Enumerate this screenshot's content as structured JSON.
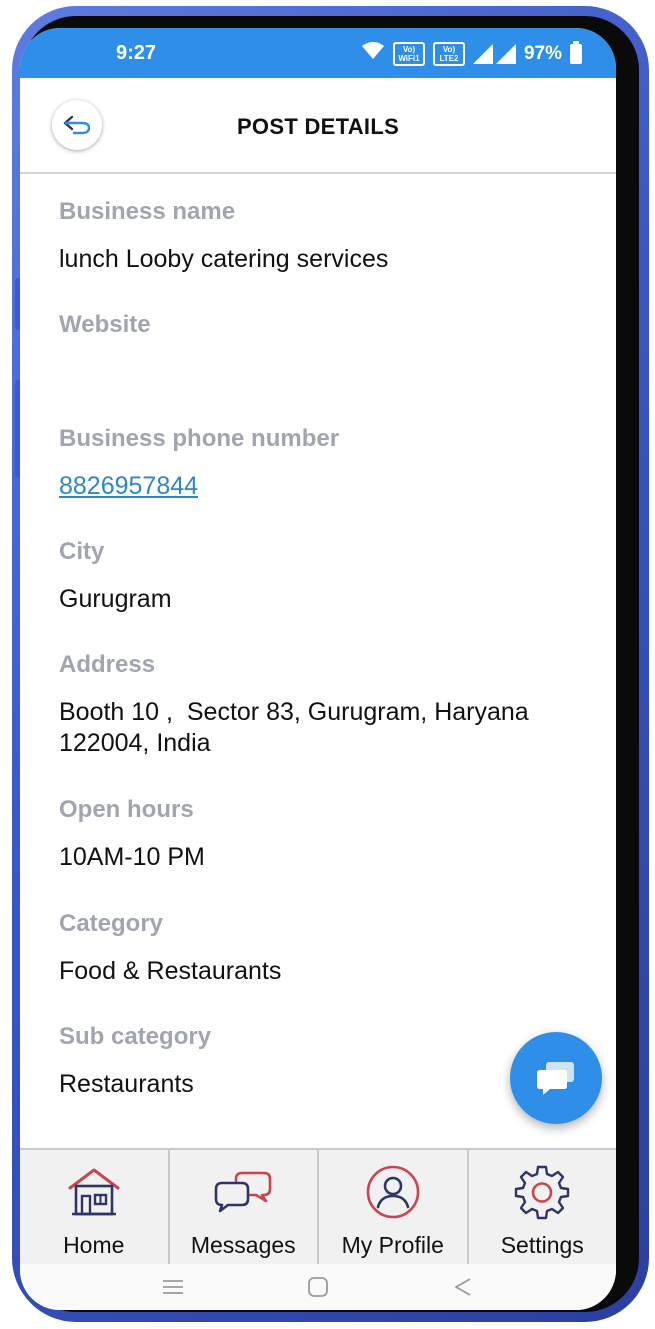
{
  "status_bar": {
    "time": "9:27",
    "sim1": "Vo) WiFi1",
    "sim2": "Vo) LTE2",
    "battery": "97%",
    "icons": [
      "wifi-icon",
      "sim1-badge-icon",
      "sim2-badge-icon",
      "signal-icon",
      "battery-icon"
    ]
  },
  "header": {
    "title": "POST DETAILS",
    "back_icon": "back-arrow-icon"
  },
  "fields": [
    {
      "label": "Business name",
      "value": "lunch Looby catering services"
    },
    {
      "label": "Website",
      "value": ""
    },
    {
      "label": "Business phone number",
      "value": "8826957844"
    },
    {
      "label": "City",
      "value": "Gurugram"
    },
    {
      "label": "Address",
      "value": "Booth 10 ,  Sector 83, Gurugram, Haryana 122004, India"
    },
    {
      "label": "Open hours",
      "value": "10AM-10 PM"
    },
    {
      "label": "Category",
      "value": "Food & Restaurants"
    },
    {
      "label": "Sub category",
      "value": "Restaurants"
    }
  ],
  "fab": {
    "icon": "chat-icon"
  },
  "tabs": [
    {
      "label": "Home",
      "icon": "home-icon"
    },
    {
      "label": "Messages",
      "icon": "messages-icon"
    },
    {
      "label": "My Profile",
      "icon": "profile-icon"
    },
    {
      "label": "Settings",
      "icon": "settings-icon"
    }
  ],
  "nav": [
    "menu-icon",
    "home-square-icon",
    "back-triangle-icon"
  ],
  "colors": {
    "primary": "#2f8fe8",
    "label_gray": "#a1a5b0",
    "link": "#2f86c9",
    "icon_red": "#c8454f",
    "icon_navy": "#2e3566",
    "phone_frame": "#3b56c4"
  }
}
